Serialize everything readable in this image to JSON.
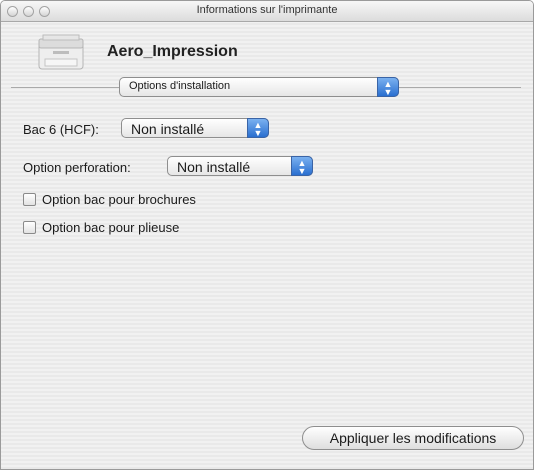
{
  "window": {
    "title": "Informations sur l'imprimante"
  },
  "printer": {
    "name": "Aero_Impression",
    "icon": "printer-icon"
  },
  "section_popup": {
    "value": "Options d'installation"
  },
  "options": {
    "tray6_label": "Bac 6 (HCF):",
    "tray6_value": "Non installé",
    "punch_label": "Option perforation:",
    "punch_value": "Non installé",
    "booklet_label": "Option bac pour brochures",
    "booklet_checked": false,
    "folder_label": "Option bac pour plieuse",
    "folder_checked": false
  },
  "apply_button": {
    "label": "Appliquer les modifications"
  }
}
